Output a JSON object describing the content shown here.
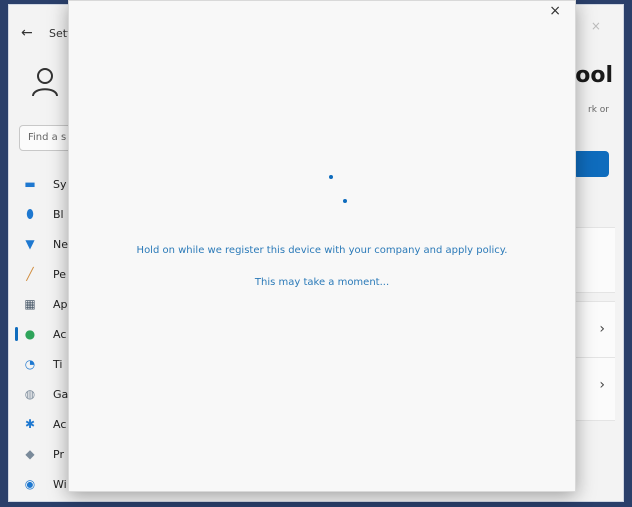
{
  "colors": {
    "accent": "#0f6cbd",
    "message": "#2b7ab8"
  },
  "settings": {
    "title": "Setti",
    "search_placeholder": "Find a s",
    "heading_partial": "ool",
    "subtext_partial": "rk or",
    "nav": [
      {
        "label": "Sy",
        "icon": "system-icon",
        "glyph": "▬",
        "color": "#1e78d0"
      },
      {
        "label": "Bl",
        "icon": "bluetooth-icon",
        "glyph": "⬮",
        "color": "#1e78d0"
      },
      {
        "label": "Ne",
        "icon": "network-icon",
        "glyph": "▼",
        "color": "#1e78d0"
      },
      {
        "label": "Pe",
        "icon": "personalization-icon",
        "glyph": "╱",
        "color": "#d08a3a"
      },
      {
        "label": "Ap",
        "icon": "apps-icon",
        "glyph": "▦",
        "color": "#4a5a6a"
      },
      {
        "label": "Ac",
        "icon": "accounts-icon",
        "glyph": "●",
        "color": "#2ea45a",
        "active": true
      },
      {
        "label": "Ti",
        "icon": "time-language-icon",
        "glyph": "◔",
        "color": "#1e78d0"
      },
      {
        "label": "Ga",
        "icon": "gaming-icon",
        "glyph": "◍",
        "color": "#7a8a9a"
      },
      {
        "label": "Ac",
        "icon": "accessibility-icon",
        "glyph": "✱",
        "color": "#1e78d0"
      },
      {
        "label": "Pr",
        "icon": "privacy-icon",
        "glyph": "◆",
        "color": "#7a8a9a"
      },
      {
        "label": "Wi",
        "icon": "windows-update-icon",
        "glyph": "◉",
        "color": "#1e78d0"
      }
    ]
  },
  "dialog": {
    "close_glyph": "×",
    "message_primary": "Hold on while we register this device with your company and apply policy.",
    "message_secondary": "This may take a moment..."
  }
}
